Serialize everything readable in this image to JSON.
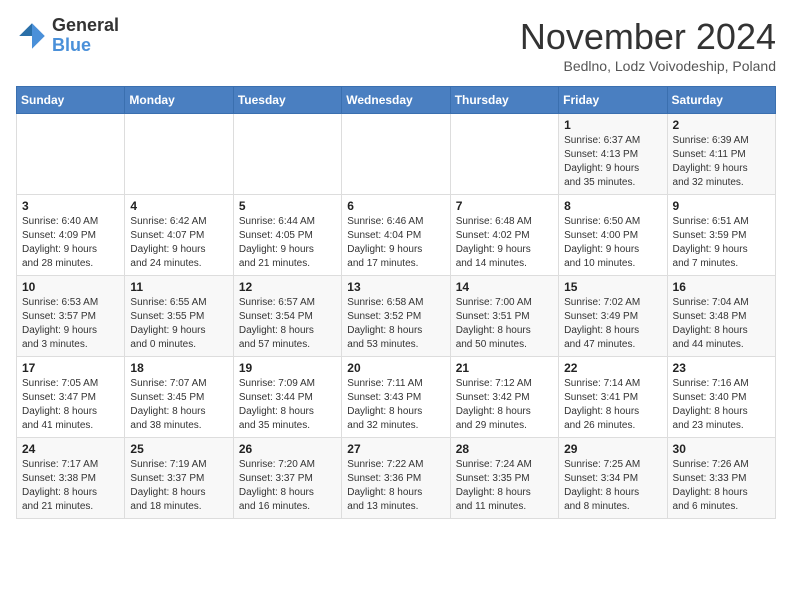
{
  "logo": {
    "general": "General",
    "blue": "Blue"
  },
  "header": {
    "title": "November 2024",
    "subtitle": "Bedlno, Lodz Voivodeship, Poland"
  },
  "weekdays": [
    "Sunday",
    "Monday",
    "Tuesday",
    "Wednesday",
    "Thursday",
    "Friday",
    "Saturday"
  ],
  "weeks": [
    [
      {
        "day": "",
        "info": ""
      },
      {
        "day": "",
        "info": ""
      },
      {
        "day": "",
        "info": ""
      },
      {
        "day": "",
        "info": ""
      },
      {
        "day": "",
        "info": ""
      },
      {
        "day": "1",
        "info": "Sunrise: 6:37 AM\nSunset: 4:13 PM\nDaylight: 9 hours\nand 35 minutes."
      },
      {
        "day": "2",
        "info": "Sunrise: 6:39 AM\nSunset: 4:11 PM\nDaylight: 9 hours\nand 32 minutes."
      }
    ],
    [
      {
        "day": "3",
        "info": "Sunrise: 6:40 AM\nSunset: 4:09 PM\nDaylight: 9 hours\nand 28 minutes."
      },
      {
        "day": "4",
        "info": "Sunrise: 6:42 AM\nSunset: 4:07 PM\nDaylight: 9 hours\nand 24 minutes."
      },
      {
        "day": "5",
        "info": "Sunrise: 6:44 AM\nSunset: 4:05 PM\nDaylight: 9 hours\nand 21 minutes."
      },
      {
        "day": "6",
        "info": "Sunrise: 6:46 AM\nSunset: 4:04 PM\nDaylight: 9 hours\nand 17 minutes."
      },
      {
        "day": "7",
        "info": "Sunrise: 6:48 AM\nSunset: 4:02 PM\nDaylight: 9 hours\nand 14 minutes."
      },
      {
        "day": "8",
        "info": "Sunrise: 6:50 AM\nSunset: 4:00 PM\nDaylight: 9 hours\nand 10 minutes."
      },
      {
        "day": "9",
        "info": "Sunrise: 6:51 AM\nSunset: 3:59 PM\nDaylight: 9 hours\nand 7 minutes."
      }
    ],
    [
      {
        "day": "10",
        "info": "Sunrise: 6:53 AM\nSunset: 3:57 PM\nDaylight: 9 hours\nand 3 minutes."
      },
      {
        "day": "11",
        "info": "Sunrise: 6:55 AM\nSunset: 3:55 PM\nDaylight: 9 hours\nand 0 minutes."
      },
      {
        "day": "12",
        "info": "Sunrise: 6:57 AM\nSunset: 3:54 PM\nDaylight: 8 hours\nand 57 minutes."
      },
      {
        "day": "13",
        "info": "Sunrise: 6:58 AM\nSunset: 3:52 PM\nDaylight: 8 hours\nand 53 minutes."
      },
      {
        "day": "14",
        "info": "Sunrise: 7:00 AM\nSunset: 3:51 PM\nDaylight: 8 hours\nand 50 minutes."
      },
      {
        "day": "15",
        "info": "Sunrise: 7:02 AM\nSunset: 3:49 PM\nDaylight: 8 hours\nand 47 minutes."
      },
      {
        "day": "16",
        "info": "Sunrise: 7:04 AM\nSunset: 3:48 PM\nDaylight: 8 hours\nand 44 minutes."
      }
    ],
    [
      {
        "day": "17",
        "info": "Sunrise: 7:05 AM\nSunset: 3:47 PM\nDaylight: 8 hours\nand 41 minutes."
      },
      {
        "day": "18",
        "info": "Sunrise: 7:07 AM\nSunset: 3:45 PM\nDaylight: 8 hours\nand 38 minutes."
      },
      {
        "day": "19",
        "info": "Sunrise: 7:09 AM\nSunset: 3:44 PM\nDaylight: 8 hours\nand 35 minutes."
      },
      {
        "day": "20",
        "info": "Sunrise: 7:11 AM\nSunset: 3:43 PM\nDaylight: 8 hours\nand 32 minutes."
      },
      {
        "day": "21",
        "info": "Sunrise: 7:12 AM\nSunset: 3:42 PM\nDaylight: 8 hours\nand 29 minutes."
      },
      {
        "day": "22",
        "info": "Sunrise: 7:14 AM\nSunset: 3:41 PM\nDaylight: 8 hours\nand 26 minutes."
      },
      {
        "day": "23",
        "info": "Sunrise: 7:16 AM\nSunset: 3:40 PM\nDaylight: 8 hours\nand 23 minutes."
      }
    ],
    [
      {
        "day": "24",
        "info": "Sunrise: 7:17 AM\nSunset: 3:38 PM\nDaylight: 8 hours\nand 21 minutes."
      },
      {
        "day": "25",
        "info": "Sunrise: 7:19 AM\nSunset: 3:37 PM\nDaylight: 8 hours\nand 18 minutes."
      },
      {
        "day": "26",
        "info": "Sunrise: 7:20 AM\nSunset: 3:37 PM\nDaylight: 8 hours\nand 16 minutes."
      },
      {
        "day": "27",
        "info": "Sunrise: 7:22 AM\nSunset: 3:36 PM\nDaylight: 8 hours\nand 13 minutes."
      },
      {
        "day": "28",
        "info": "Sunrise: 7:24 AM\nSunset: 3:35 PM\nDaylight: 8 hours\nand 11 minutes."
      },
      {
        "day": "29",
        "info": "Sunrise: 7:25 AM\nSunset: 3:34 PM\nDaylight: 8 hours\nand 8 minutes."
      },
      {
        "day": "30",
        "info": "Sunrise: 7:26 AM\nSunset: 3:33 PM\nDaylight: 8 hours\nand 6 minutes."
      }
    ]
  ]
}
